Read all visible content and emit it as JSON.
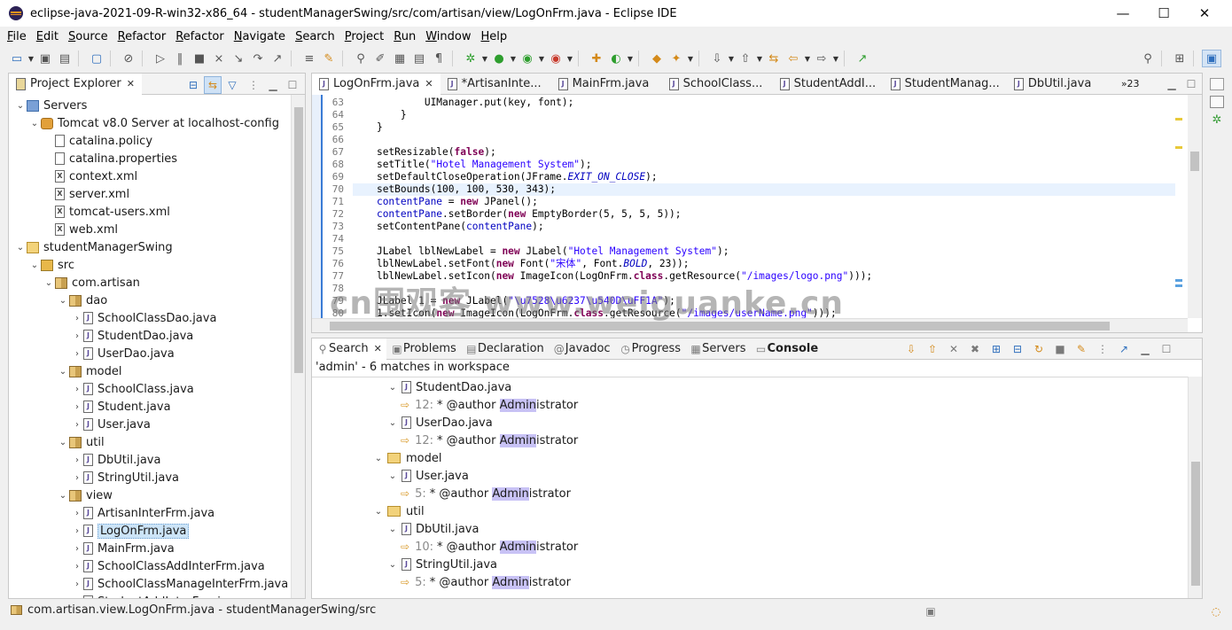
{
  "window": {
    "title": "eclipse-java-2021-09-R-win32-x86_64 - studentManagerSwing/src/com/artisan/view/LogOnFrm.java - Eclipse IDE",
    "minimize": "—",
    "maximize": "☐",
    "close": "✕"
  },
  "menu": [
    "File",
    "Edit",
    "Source",
    "Refactor",
    "Refactor",
    "Navigate",
    "Search",
    "Project",
    "Run",
    "Window",
    "Help"
  ],
  "explorer": {
    "title": "Project Explorer",
    "tree": [
      {
        "label": "Servers",
        "depth": 0,
        "arrow": "⌄",
        "icon": "servers"
      },
      {
        "label": "Tomcat v8.0 Server at localhost-config",
        "depth": 1,
        "arrow": "⌄",
        "icon": "tomcat"
      },
      {
        "label": "catalina.policy",
        "depth": 2,
        "arrow": "",
        "icon": "file"
      },
      {
        "label": "catalina.properties",
        "depth": 2,
        "arrow": "",
        "icon": "file"
      },
      {
        "label": "context.xml",
        "depth": 2,
        "arrow": "",
        "icon": "xml"
      },
      {
        "label": "server.xml",
        "depth": 2,
        "arrow": "",
        "icon": "xml"
      },
      {
        "label": "tomcat-users.xml",
        "depth": 2,
        "arrow": "",
        "icon": "xml"
      },
      {
        "label": "web.xml",
        "depth": 2,
        "arrow": "",
        "icon": "xml"
      },
      {
        "label": "studentManagerSwing",
        "depth": 0,
        "arrow": "⌄",
        "icon": "proj"
      },
      {
        "label": "src",
        "depth": 1,
        "arrow": "⌄",
        "icon": "src"
      },
      {
        "label": "com.artisan",
        "depth": 2,
        "arrow": "⌄",
        "icon": "pkg"
      },
      {
        "label": "dao",
        "depth": 3,
        "arrow": "⌄",
        "icon": "pkg"
      },
      {
        "label": "SchoolClassDao.java",
        "depth": 4,
        "arrow": "›",
        "icon": "java"
      },
      {
        "label": "StudentDao.java",
        "depth": 4,
        "arrow": "›",
        "icon": "java"
      },
      {
        "label": "UserDao.java",
        "depth": 4,
        "arrow": "›",
        "icon": "java"
      },
      {
        "label": "model",
        "depth": 3,
        "arrow": "⌄",
        "icon": "pkg"
      },
      {
        "label": "SchoolClass.java",
        "depth": 4,
        "arrow": "›",
        "icon": "java"
      },
      {
        "label": "Student.java",
        "depth": 4,
        "arrow": "›",
        "icon": "java"
      },
      {
        "label": "User.java",
        "depth": 4,
        "arrow": "›",
        "icon": "java"
      },
      {
        "label": "util",
        "depth": 3,
        "arrow": "⌄",
        "icon": "pkg"
      },
      {
        "label": "DbUtil.java",
        "depth": 4,
        "arrow": "›",
        "icon": "java"
      },
      {
        "label": "StringUtil.java",
        "depth": 4,
        "arrow": "›",
        "icon": "java"
      },
      {
        "label": "view",
        "depth": 3,
        "arrow": "⌄",
        "icon": "pkg"
      },
      {
        "label": "ArtisanInterFrm.java",
        "depth": 4,
        "arrow": "›",
        "icon": "java"
      },
      {
        "label": "LogOnFrm.java",
        "depth": 4,
        "arrow": "›",
        "icon": "java",
        "selected": true
      },
      {
        "label": "MainFrm.java",
        "depth": 4,
        "arrow": "›",
        "icon": "java"
      },
      {
        "label": "SchoolClassAddInterFrm.java",
        "depth": 4,
        "arrow": "›",
        "icon": "java"
      },
      {
        "label": "SchoolClassManageInterFrm.java",
        "depth": 4,
        "arrow": "›",
        "icon": "java"
      },
      {
        "label": "StudentAddInterFrm.java",
        "depth": 4,
        "arrow": "›",
        "icon": "java"
      }
    ]
  },
  "editor": {
    "tabs": [
      {
        "label": "LogOnFrm.java",
        "active": true,
        "close": "✕"
      },
      {
        "label": "*ArtisanInte...",
        "active": false
      },
      {
        "label": "MainFrm.java",
        "active": false
      },
      {
        "label": "SchoolClass...",
        "active": false
      },
      {
        "label": "StudentAddI...",
        "active": false
      },
      {
        "label": "StudentManag...",
        "active": false
      },
      {
        "label": "DbUtil.java",
        "active": false
      }
    ],
    "overflow_count": "»23",
    "lines": [
      {
        "n": "63",
        "code": "            UIManager.put(key, font);"
      },
      {
        "n": "64",
        "code": "        }"
      },
      {
        "n": "65",
        "code": "    }"
      },
      {
        "n": "66",
        "code": ""
      },
      {
        "n": "67",
        "code": "    setResizable(false);"
      },
      {
        "n": "68",
        "code": "    setTitle(\"Hotel Management System\");"
      },
      {
        "n": "69",
        "code": "    setDefaultCloseOperation(JFrame.EXIT_ON_CLOSE);"
      },
      {
        "n": "70",
        "code": "    setBounds(100, 100, 530, 343);",
        "current": true
      },
      {
        "n": "71",
        "code": "    contentPane = new JPanel();"
      },
      {
        "n": "72",
        "code": "    contentPane.setBorder(new EmptyBorder(5, 5, 5, 5));"
      },
      {
        "n": "73",
        "code": "    setContentPane(contentPane);"
      },
      {
        "n": "74",
        "code": ""
      },
      {
        "n": "75",
        "code": "    JLabel lblNewLabel = new JLabel(\"Hotel Management System\");"
      },
      {
        "n": "76",
        "code": "    lblNewLabel.setFont(new Font(\"宋体\", Font.BOLD, 23));"
      },
      {
        "n": "77",
        "code": "    lblNewLabel.setIcon(new ImageIcon(LogOnFrm.class.getResource(\"/images/logo.png\")));"
      },
      {
        "n": "78",
        "code": ""
      },
      {
        "n": "79",
        "code": "    JLabel lblNewLabel_1 = new JLabel(\"\\u7528\\u6237\\u540D\\uFF1A\");"
      },
      {
        "n": "80",
        "code": "    lblNewLabel_1.setIcon(new ImageIcon(LogOnFrm.class.getResource(\"/images/userName.png\")));"
      }
    ]
  },
  "bottom": {
    "tabs": [
      "Search",
      "Problems",
      "Declaration",
      "Javadoc",
      "Progress",
      "Servers",
      "Console"
    ],
    "summary": "'admin' - 6 matches in workspace",
    "results": [
      {
        "kind": "file",
        "label": "StudentDao.java",
        "depth": 1
      },
      {
        "kind": "match",
        "line": "12:",
        "pre": "* @author ",
        "hit": "Admin",
        "post": "istrator",
        "depth": 2
      },
      {
        "kind": "file",
        "label": "UserDao.java",
        "depth": 1
      },
      {
        "kind": "match",
        "line": "12:",
        "pre": "* @author ",
        "hit": "Admin",
        "post": "istrator",
        "depth": 2
      },
      {
        "kind": "folder",
        "label": "model",
        "depth": 0
      },
      {
        "kind": "file",
        "label": "User.java",
        "depth": 1
      },
      {
        "kind": "match",
        "line": "5:",
        "pre": "* @author ",
        "hit": "Admin",
        "post": "istrator",
        "depth": 2
      },
      {
        "kind": "folder",
        "label": "util",
        "depth": 0
      },
      {
        "kind": "file",
        "label": "DbUtil.java",
        "depth": 1
      },
      {
        "kind": "match",
        "line": "10:",
        "pre": "* @author ",
        "hit": "Admin",
        "post": "istrator",
        "depth": 2
      },
      {
        "kind": "file",
        "label": "StringUtil.java",
        "depth": 1
      },
      {
        "kind": "match",
        "line": "5:",
        "pre": "* @author ",
        "hit": "Admin",
        "post": "istrator",
        "depth": 2
      }
    ]
  },
  "status": {
    "text": "com.artisan.view.LogOnFrm.java - studentManagerSwing/src"
  },
  "watermark": "cn围观客 www.weiguanke.cn",
  "colors": {
    "accent": "#3a7bd5",
    "keyword": "#7f0055",
    "string": "#2a00ff",
    "field": "#0000c0",
    "highlight": "#c8c2f5"
  }
}
